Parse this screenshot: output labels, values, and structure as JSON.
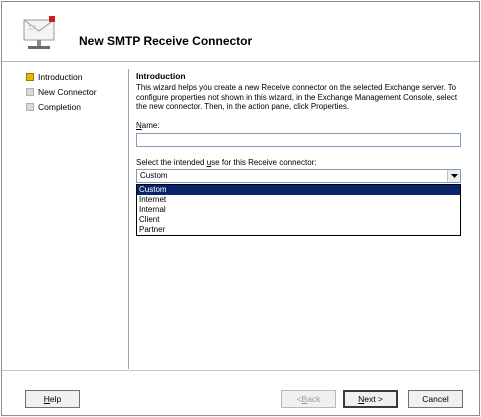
{
  "window": {
    "title": "New SMTP Receive Connector"
  },
  "steps": [
    {
      "label": "Introduction",
      "state": "active"
    },
    {
      "label": "New Connector",
      "state": "pending"
    },
    {
      "label": "Completion",
      "state": "pending"
    }
  ],
  "content": {
    "section_title": "Introduction",
    "intro_text": "This wizard helps you create a new Receive connector on the selected Exchange server. To configure properties not shown in this wizard, in the Exchange Management Console, select the new connector. Then, in the action pane, click Properties.",
    "name_label": "Name:",
    "name_value": "",
    "use_label": "Select the intended use for this Receive connector:",
    "use_selected": "Custom",
    "use_options": [
      "Custom",
      "Internet",
      "Internal",
      "Client",
      "Partner"
    ]
  },
  "buttons": {
    "help": "Help",
    "back": "< Back",
    "next": "Next >",
    "cancel": "Cancel"
  },
  "colors": {
    "active_step": "#e8b800",
    "selection": "#0a246a"
  }
}
